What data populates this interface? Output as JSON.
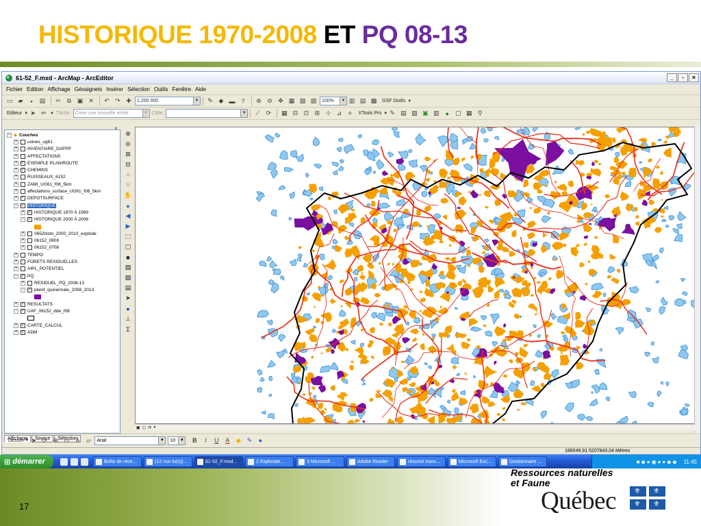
{
  "slide": {
    "title_part1": "HISTORIQUE 1970-2008",
    "title_part2": "ET",
    "title_part3": "PQ 08-13",
    "page_number": "17",
    "org_line1": "Ressources naturelles",
    "org_line2": "et Faune",
    "org_name": "Québec"
  },
  "window": {
    "title": "61-52_F.mxd - ArcMap - ArcEditor",
    "controls": [
      "_",
      "▫",
      "×"
    ]
  },
  "menu": [
    "Fichier",
    "Edition",
    "Affichage",
    "Géosignets",
    "Insérer",
    "Sélection",
    "Outils",
    "Fenêtre",
    "Aide"
  ],
  "toolbar1": {
    "scale": "1:200 000",
    "zoom": "100%",
    "gsf_label": "GSF Outils"
  },
  "toolbar2": {
    "editor_label": "Editeur",
    "task_label": "Tâche:",
    "task_value": "Créer une nouvelle entité",
    "target_label": "Cible:",
    "xtools_label": "XTools Pro"
  },
  "toc": {
    "root": "Couches",
    "layers": [
      {
        "label": "usines_ug61",
        "level": 1,
        "pm": "+",
        "checked": false
      },
      {
        "label": "INVENTAIRE_DAFPP",
        "level": 1,
        "pm": "+",
        "checked": false
      },
      {
        "label": "AFFECTATIONS",
        "level": 1,
        "pm": "+",
        "checked": false
      },
      {
        "label": "EXEMPLE PLANIROUTE",
        "level": 1,
        "pm": "+",
        "checked": true
      },
      {
        "label": "CHEMINS",
        "level": 1,
        "pm": "+",
        "checked": true
      },
      {
        "label": "RUISSEAUX_6152",
        "level": 1,
        "pm": "+",
        "checked": false
      },
      {
        "label": "ZAMI_UG61_f08_5km",
        "level": 1,
        "pm": "+",
        "checked": false
      },
      {
        "label": "affectations_surface_UG61_f08_5km",
        "level": 1,
        "pm": "+",
        "checked": false
      },
      {
        "label": "DEPOTSURFACE",
        "level": 1,
        "pm": "+",
        "checked": true
      },
      {
        "label": "HISTORIQUE",
        "level": 1,
        "pm": "−",
        "checked": true,
        "selected": true
      },
      {
        "label": "HISTORIQUE 1970 À 1999",
        "level": 2,
        "pm": "+",
        "checked": true
      },
      {
        "label": "HISTORIQUE 2000 À 2008",
        "level": 2,
        "pm": "−",
        "checked": true
      },
      {
        "swatch": "#f5a000",
        "level": 3
      },
      {
        "label": "0652histo_2000_2010_explode",
        "level": 2,
        "pm": "+",
        "checked": false
      },
      {
        "label": "06152_0809",
        "level": 2,
        "pm": "+",
        "checked": false
      },
      {
        "label": "06152_0708",
        "level": 2,
        "pm": "+",
        "checked": false
      },
      {
        "label": "TEMPO",
        "level": 1,
        "pm": "+",
        "checked": false
      },
      {
        "label": "FORETS RESIDUELLES",
        "level": 1,
        "pm": "+",
        "checked": false
      },
      {
        "label": "AIPL_POTENTIEL",
        "level": 1,
        "pm": "+",
        "checked": false
      },
      {
        "label": "PQ",
        "level": 1,
        "pm": "−",
        "checked": true
      },
      {
        "label": "RESIDUEL_PQ_2008-13",
        "level": 2,
        "pm": "+",
        "checked": false
      },
      {
        "label": "planif_quinennale_2008_2013",
        "level": 2,
        "pm": "−",
        "checked": true
      },
      {
        "swatch": "#7a0fa0",
        "level": 3
      },
      {
        "label": "RESULTATS",
        "level": 1,
        "pm": "+",
        "checked": true
      },
      {
        "label": "UAF_06152_dde_f08",
        "level": 1,
        "pm": "−",
        "checked": true
      },
      {
        "swatch": "outline",
        "level": 2
      },
      {
        "label": "CARTE_CALCUL",
        "level": 1,
        "pm": "+",
        "checked": true
      },
      {
        "label": "ADM",
        "level": 1,
        "pm": "+",
        "checked": true
      }
    ],
    "tabs": [
      "Affichage",
      "Source",
      "Sélection"
    ]
  },
  "drawbar": {
    "draw_label": "Dessin",
    "font": "Arial",
    "size": "10",
    "bold": "B",
    "italic": "I",
    "underline": "U"
  },
  "status": {
    "coordinates": "186049,91  5207843,04 Mètres"
  },
  "taskbar": {
    "start_label": "démarrer",
    "tasks": [
      "Boîte de réce...",
      "(12 non lu(s))...",
      "61-52_F.mxd...",
      "2 Explorate...",
      "3 Microsoft ...",
      "Adobe Reader",
      "résumé trans...",
      "Microsoft Exc...",
      "Gestionnaire ..."
    ],
    "active_task": 2,
    "clock": "11:45"
  },
  "colors": {
    "historique": "#f5a000",
    "pq": "#7a0fa0",
    "roads": "#e8321e",
    "water": "#8ec8ee",
    "boundary": "#000000"
  }
}
